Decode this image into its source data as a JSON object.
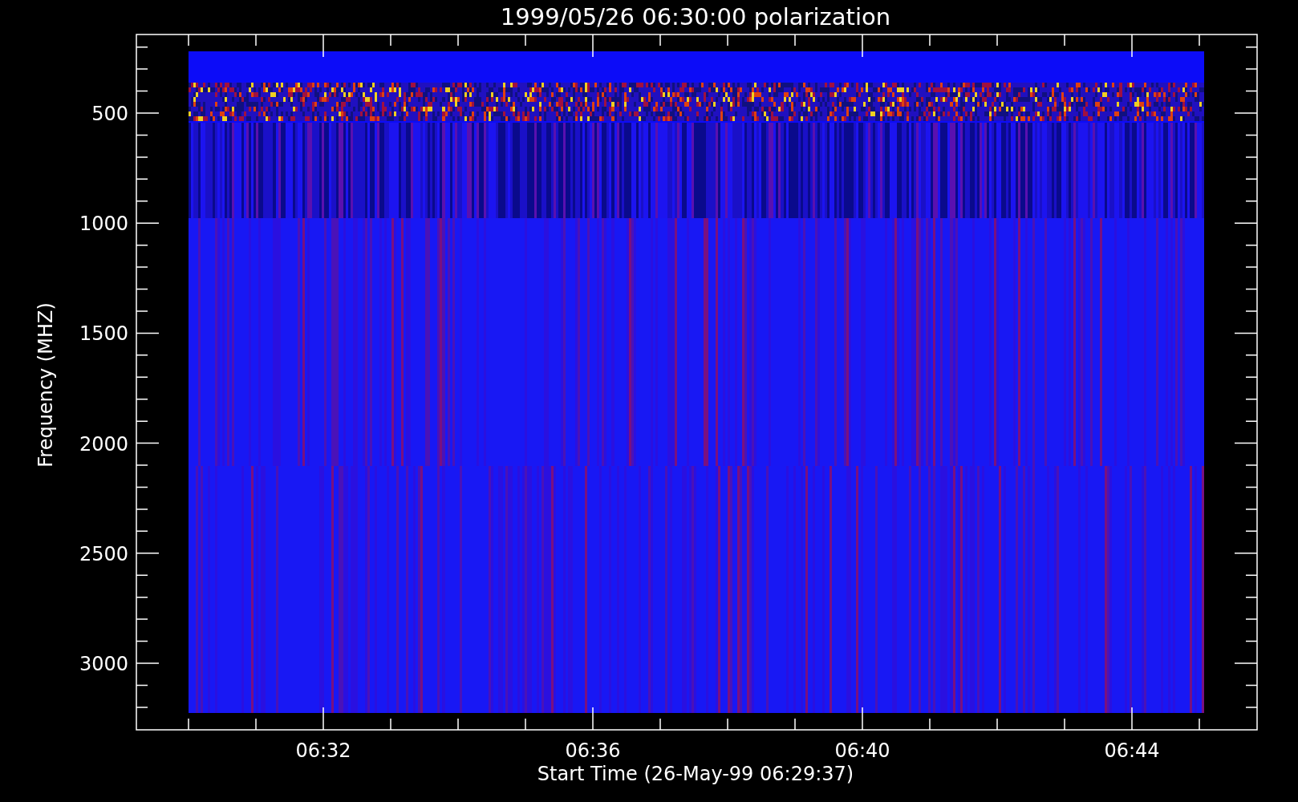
{
  "title": "1999/05/26 06:30:00 polarization",
  "y_axis": {
    "label": "Frequency (MHZ)",
    "tick_labels": [
      "500",
      "1000",
      "1500",
      "2000",
      "2500",
      "3000"
    ]
  },
  "x_axis": {
    "label": "Start Time (26-May-99 06:29:37)",
    "tick_labels": [
      "06:32",
      "06:36",
      "06:40",
      "06:44"
    ]
  }
}
